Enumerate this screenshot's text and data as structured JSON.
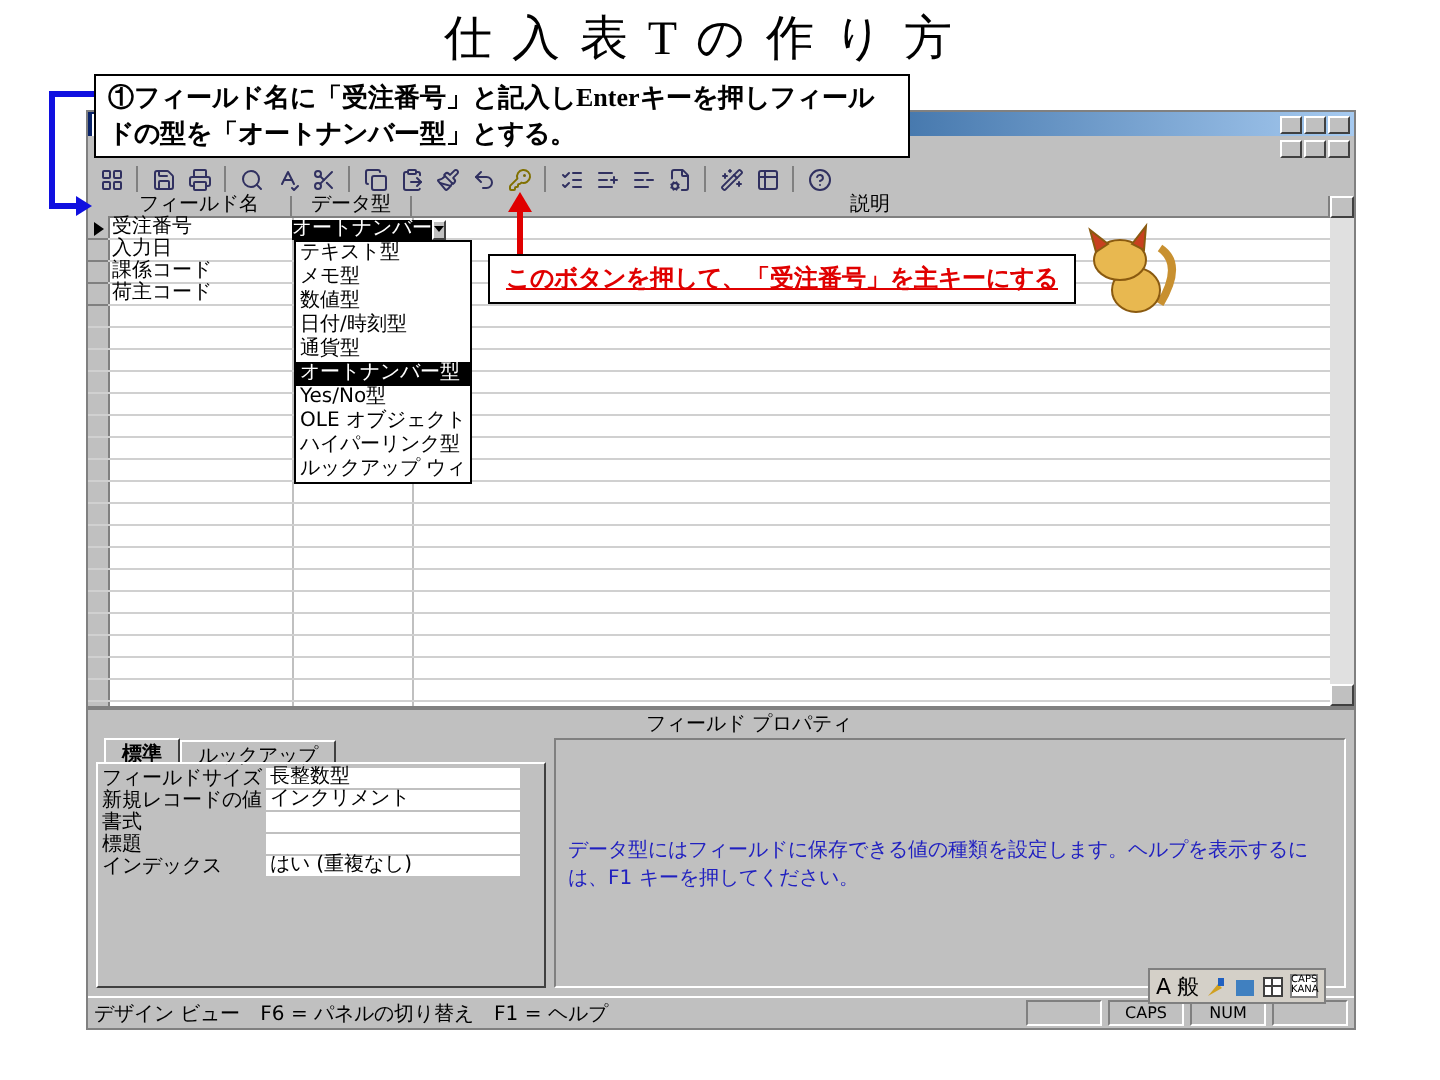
{
  "slide_title": "仕 入 表 T の 作 り 方",
  "instruction": "①フィールド名に「受注番号」と記入しEnterキーを押しフィールドの型を「オートナンバー型」とする。",
  "hint": "このボタンを押して、「受注番号」を主キーにする",
  "grid": {
    "columns": [
      "フィールド名",
      "データ型",
      "説明"
    ],
    "rows": [
      {
        "field": "受注番号",
        "type": "オートナンバー",
        "selected": true
      },
      {
        "field": "入力日",
        "type": "",
        "selected": false
      },
      {
        "field": "課係コード",
        "type": "",
        "selected": false
      },
      {
        "field": "荷主コード",
        "type": "",
        "selected": false
      }
    ],
    "type_dropdown": [
      {
        "label": "テキスト型",
        "selected": false
      },
      {
        "label": "メモ型",
        "selected": false
      },
      {
        "label": "数値型",
        "selected": false
      },
      {
        "label": "日付/時刻型",
        "selected": false
      },
      {
        "label": "通貨型",
        "selected": false
      },
      {
        "label": "オートナンバー型",
        "selected": true
      },
      {
        "label": "Yes/No型",
        "selected": false
      },
      {
        "label": "OLE オブジェクト",
        "selected": false
      },
      {
        "label": "ハイパーリンク型",
        "selected": false
      },
      {
        "label": "ルックアップ ウィ",
        "selected": false
      }
    ]
  },
  "properties": {
    "header": "フィールド プロパティ",
    "tabs": [
      {
        "label": "標準",
        "selected": true
      },
      {
        "label": "ルックアップ",
        "selected": false
      }
    ],
    "rows": [
      {
        "name": "フィールドサイズ",
        "value": "長整数型"
      },
      {
        "name": "新規レコードの値",
        "value": "インクリメント"
      },
      {
        "name": "書式",
        "value": ""
      },
      {
        "name": "標題",
        "value": ""
      },
      {
        "name": "インデックス",
        "value": "はい (重複なし)"
      }
    ],
    "help": "データ型にはフィールドに保存できる値の種類を設定します。ヘルプを表示するには、F1 キーを押してください。"
  },
  "status_bar": {
    "text": "デザイン ビュー　F6 = パネルの切り替え　F1 = ヘルプ",
    "panes": [
      "CAPS",
      "NUM"
    ]
  },
  "ime_bar": {
    "labels": [
      "A",
      "般"
    ],
    "mode": "CAPS KANA"
  }
}
